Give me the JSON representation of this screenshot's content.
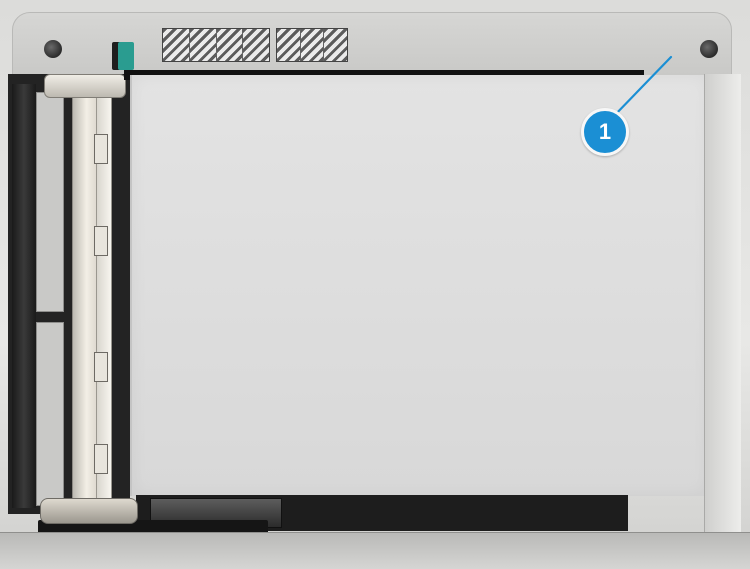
{
  "callout": {
    "number": "1",
    "badge_color": "#1b8fd4",
    "line_color": "#1b8fd4"
  },
  "scene": {
    "subject_icon": "scanner-platen-icon",
    "accent_color": "#2a9c90"
  }
}
